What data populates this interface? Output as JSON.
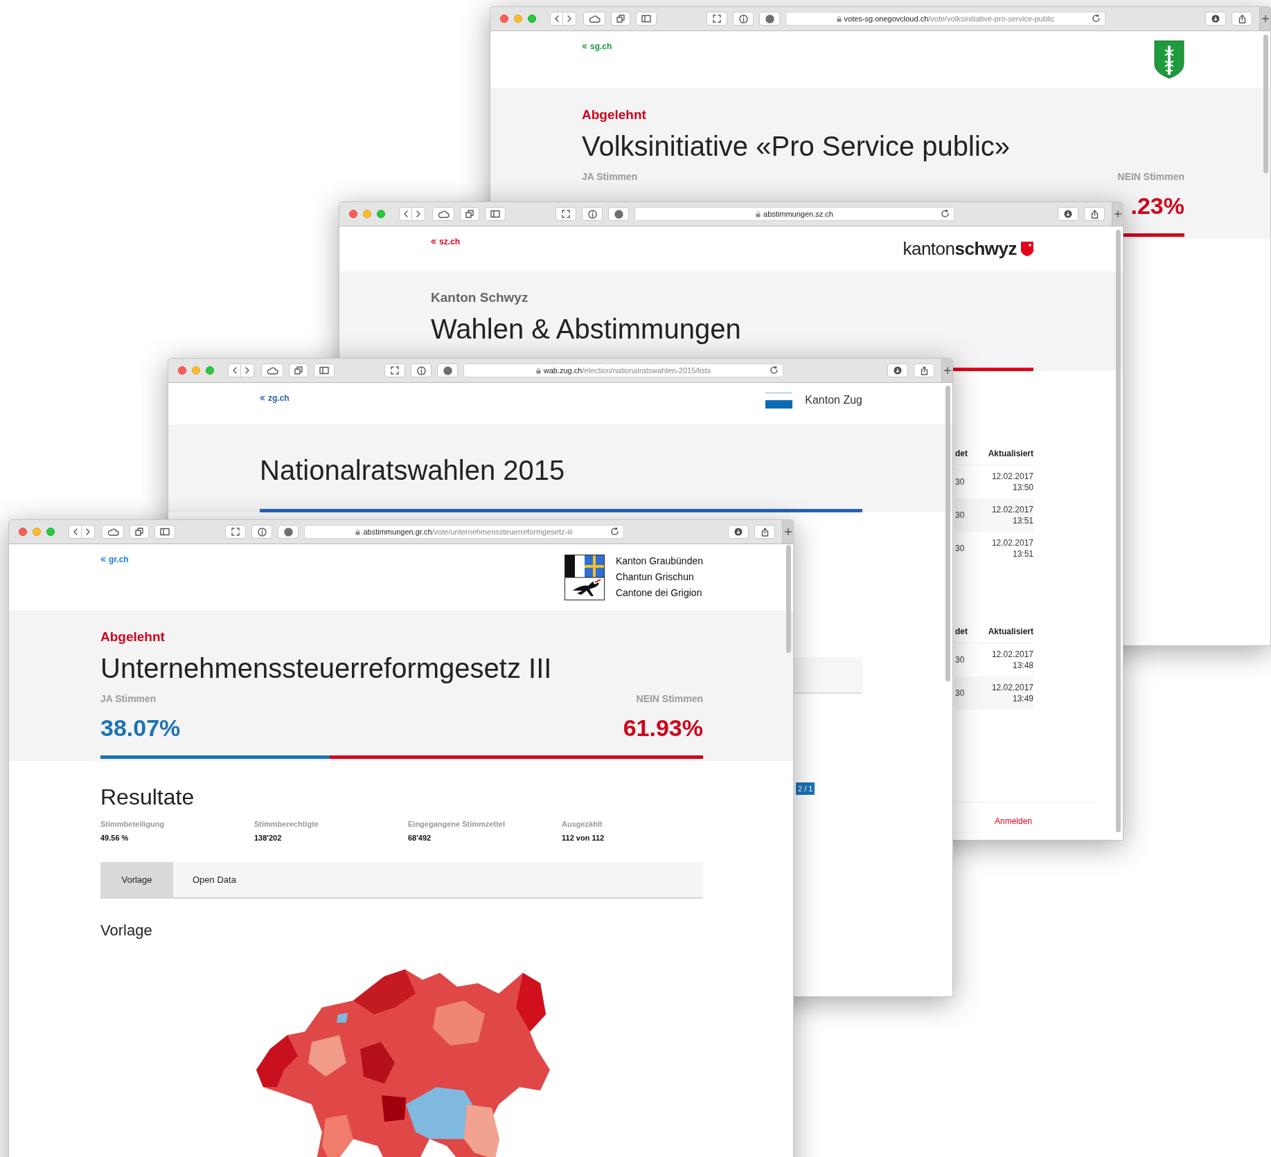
{
  "windows": [
    {
      "kind": "vote",
      "url": {
        "host": "votes-sg.onegovcloud.ch",
        "path": "/vote/volksinitiative-pro-service-public"
      },
      "back_link": "sg.ch",
      "color": "#1d9b3b",
      "logo": {
        "kind": "shield"
      },
      "accepted": false,
      "status": "Abgelehnt",
      "title": "Volksinitiative «Pro Service public»",
      "yes_label": "JA Stimmen",
      "no_label": "NEIN Stimmen",
      "no_value": ".23%"
    },
    {
      "kind": "overview",
      "url": {
        "host": "abstimmungen.sz.ch"
      },
      "back_link": "sz.ch",
      "color": "#e3001b",
      "logo": {
        "kind": "wordmark",
        "text": "kanton**schwyz**"
      },
      "subtitle": "Kanton Schwyz",
      "title": "Wahlen & Abstimmungen",
      "tables": [
        {
          "columns": [
            "det",
            "Aktualisiert"
          ],
          "rows": [
            [
              "30",
              "12.02.2017 13:50"
            ],
            [
              "30",
              "12.02.2017 13:51"
            ],
            [
              "30",
              "12.02.2017 13:51"
            ]
          ]
        },
        {
          "columns": [
            "det",
            "Aktualisiert"
          ],
          "rows": [
            [
              "30",
              "12.02.2017 13:48"
            ],
            [
              "30",
              "12.02.2017 13:49"
            ]
          ]
        }
      ],
      "footer_link": "Anmelden"
    },
    {
      "kind": "election",
      "url": {
        "host": "wab.zug.ch",
        "path": "/election/nationalratswahlen-2015/lists"
      },
      "back_link": "zg.ch",
      "color": "#2a62b8",
      "logo": {
        "kind": "bar",
        "text": "Kanton Zug"
      },
      "title": "Nationalratswahlen 2015",
      "badge": "2 / 1"
    },
    {
      "kind": "vote",
      "url": {
        "host": "abstimmungen.gr.ch",
        "path": "/vote/unternehmenssteuerreformgesetz-iii"
      },
      "back_link": "gr.ch",
      "color": "#1a7fe0",
      "logo": {
        "kind": "coat_of_arms",
        "lines": [
          "Kanton Graubünden",
          "Chantun Grischun",
          "Cantone dei Grigion"
        ]
      },
      "accepted": false,
      "status": "Abgelehnt",
      "title": "Unternehmenssteuerreformgesetz III",
      "yes_label": "JA Stimmen",
      "no_label": "NEIN Stimmen",
      "yes_value": "38.07%",
      "no_value": "61.93%",
      "level": 0.3807,
      "results": {
        "title": "Resultate",
        "stats": [
          {
            "label": "Stimmbeteiligung",
            "value": "49.56 %"
          },
          {
            "label": "Stimmberechtigte",
            "value": "138'202"
          },
          {
            "label": "Eingegangene Stimmzettel",
            "value": "68'492"
          },
          {
            "label": "Ausgezählt",
            "value": "112 von 112"
          }
        ]
      },
      "tabs": [
        {
          "label": "Vorlage",
          "selected": true
        },
        {
          "label": "Open Data",
          "selected": false
        }
      ],
      "section_title": "Vorlage"
    }
  ]
}
